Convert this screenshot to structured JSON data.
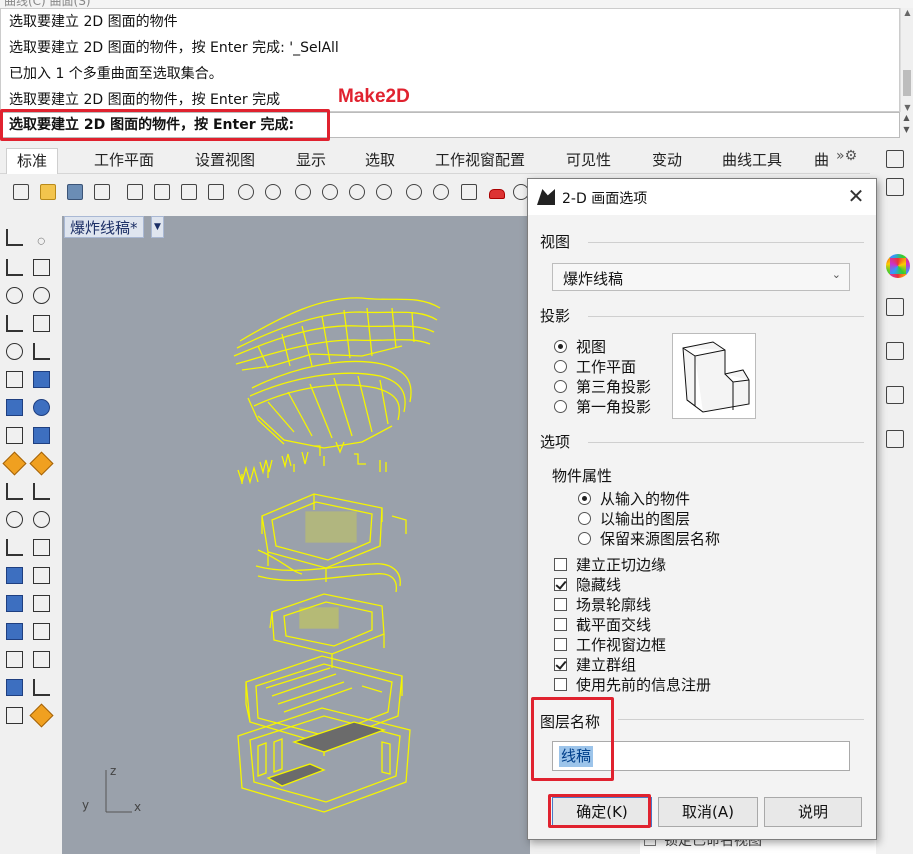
{
  "history": {
    "lines": [
      "选取要建立 2D 图面的物件",
      "选取要建立 2D 图面的物件，按 Enter 完成: '_SelAll",
      "已加入 1 个多重曲面至选取集合。",
      "选取要建立 2D 图面的物件，按 Enter 完成"
    ],
    "annotation": "Make2D"
  },
  "command_prompt": "选取要建立 2D 图面的物件，按 Enter 完成:",
  "tabs": [
    "标准",
    "工作平面",
    "设置视图",
    "显示",
    "选取",
    "工作视窗配置",
    "可见性",
    "变动",
    "曲线工具",
    "曲"
  ],
  "active_tab": "标准",
  "toolbar_icons": [
    "new-file-icon",
    "open-folder-icon",
    "save-icon",
    "print-icon",
    "import-icon",
    "cut-icon",
    "copy-icon",
    "paste-icon",
    "undo-icon",
    "pan-icon",
    "rotate-view-icon",
    "zoom-icon",
    "zoom-window-icon",
    "zoom-extents-icon",
    "zoom-selected-icon",
    "zoom-dynamic-icon",
    "four-viewports-icon",
    "render-car-icon",
    "render-preview-icon"
  ],
  "viewport": {
    "title": "爆炸线稿*",
    "axis_labels": {
      "z": "z",
      "y": "y",
      "x": "x"
    },
    "wire_color": "#f5f500"
  },
  "dialog": {
    "title": "2-D 画面选项",
    "view_label": "视图",
    "view_selected": "爆炸线稿",
    "projection_label": "投影",
    "projection_options": [
      "视图",
      "工作平面",
      "第三角投影",
      "第一角投影"
    ],
    "projection_selected": 0,
    "options_label": "选项",
    "object_props_label": "物件属性",
    "object_props_options": [
      "从输入的物件",
      "以输出的图层",
      "保留来源图层名称"
    ],
    "object_props_selected": 0,
    "checkboxes": [
      {
        "label": "建立正切边缘",
        "checked": false
      },
      {
        "label": "隐藏线",
        "checked": true
      },
      {
        "label": "场景轮廓线",
        "checked": false
      },
      {
        "label": "截平面交线",
        "checked": false
      },
      {
        "label": "工作视窗边框",
        "checked": false
      },
      {
        "label": "建立群组",
        "checked": true
      },
      {
        "label": "使用先前的信息注册",
        "checked": false
      }
    ],
    "layer_name_label": "图层名称",
    "layer_name_value": "线稿",
    "buttons": {
      "ok": "确定(K)",
      "cancel": "取消(A)",
      "help": "说明"
    }
  },
  "background_panel_text": "锁定已命名视图",
  "accent_color": "#e0222f"
}
